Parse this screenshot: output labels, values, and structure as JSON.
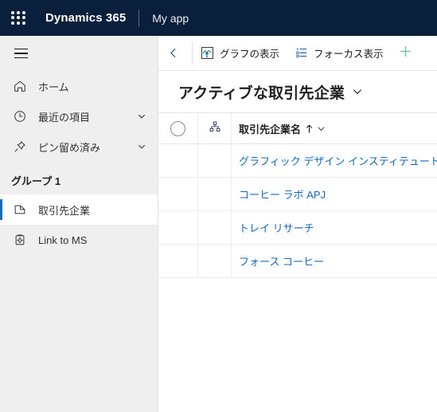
{
  "topnav": {
    "waffle_icon": "app-launcher-waffle-icon",
    "brand": "Dynamics 365",
    "app_name": "My app"
  },
  "sidebar": {
    "hamburger_icon": "hamburger-menu-icon",
    "items": [
      {
        "label": "ホーム",
        "icon": "home-icon",
        "expandable": false,
        "selected": false
      },
      {
        "label": "最近の項目",
        "icon": "clock-icon",
        "expandable": true,
        "selected": false
      },
      {
        "label": "ピン留め済み",
        "icon": "pin-icon",
        "expandable": true,
        "selected": false
      }
    ],
    "group": {
      "title": "グループ 1",
      "items": [
        {
          "label": "取引先企業",
          "icon": "account-icon",
          "selected": true
        },
        {
          "label": "Link to MS",
          "icon": "clipboard-icon",
          "selected": false
        }
      ]
    }
  },
  "commandbar": {
    "back_icon": "back-arrow-icon",
    "buttons": [
      {
        "label": "グラフの表示",
        "icon": "show-chart-icon"
      },
      {
        "label": "フォーカス表示",
        "icon": "focus-view-icon"
      }
    ],
    "new_icon": "plus-icon"
  },
  "view": {
    "title": "アクティブな取引先企業",
    "chevron_icon": "chevron-down-icon"
  },
  "grid": {
    "select_all_icon": "select-all-circle-icon",
    "hierarchy_icon": "hierarchy-icon",
    "column_header": "取引先企業名",
    "sort_icon": "sort-ascending-arrow-icon",
    "column_chevron_icon": "chevron-down-icon",
    "rows": [
      {
        "name": "グラフィック デザイン インスティテュート"
      },
      {
        "name": "コーヒー ラボ APJ"
      },
      {
        "name": "トレイ リサーチ"
      },
      {
        "name": "フォース コーヒー"
      }
    ]
  },
  "colors": {
    "navbar": "#091f3c",
    "sidebar": "#efeff0",
    "accent": "#0f6cbd",
    "link": "#1268c3",
    "plus_green": "#7ac79a"
  }
}
